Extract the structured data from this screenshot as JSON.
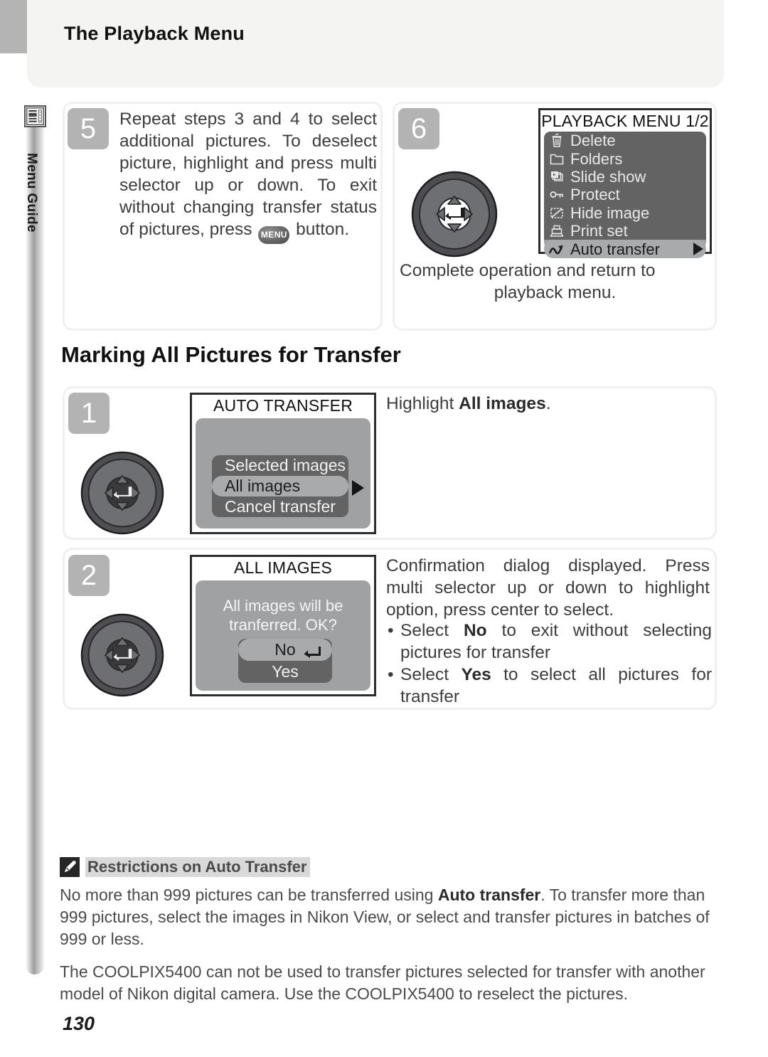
{
  "header": {
    "title": "The Playback Menu"
  },
  "side_tab": {
    "label": "Menu Guide",
    "icon": "menu-list-icon"
  },
  "section_heading": "Marking All Pictures for Transfer",
  "page_number": "130",
  "steps": {
    "step5": {
      "number": "5",
      "text_before_button": "Repeat steps 3 and 4 to select additional pictures.  To deselect picture, highlight and press multi selector up or down.  To exit without changing transfer status of pictures, press ",
      "button_label": "MENU",
      "text_after_button": " button."
    },
    "step6": {
      "number": "6",
      "caption_main": "Complete operation and return to",
      "caption_last": "playback menu.",
      "screen": {
        "title": "PLAYBACK MENU 1/2",
        "items": [
          {
            "icon": "trash-icon",
            "label": "Delete",
            "selected": false
          },
          {
            "icon": "folder-icon",
            "label": "Folders",
            "selected": false
          },
          {
            "icon": "slideshow-icon",
            "label": "Slide show",
            "selected": false
          },
          {
            "icon": "key-icon",
            "label": "Protect",
            "selected": false
          },
          {
            "icon": "hide-image-icon",
            "label": "Hide image",
            "selected": false
          },
          {
            "icon": "printer-icon",
            "label": "Print set",
            "selected": false
          },
          {
            "icon": "auto-transfer-icon",
            "label": "Auto transfer",
            "selected": true
          }
        ]
      }
    },
    "step1": {
      "number": "1",
      "caption_plain": "Highlight ",
      "caption_bold": "All images",
      "caption_tail": ".",
      "screen": {
        "title": "AUTO TRANSFER",
        "options": [
          {
            "label": "Selected images",
            "selected": false
          },
          {
            "label": "All images",
            "selected": true
          },
          {
            "label": "Cancel transfer",
            "selected": false
          }
        ]
      }
    },
    "step2": {
      "number": "2",
      "caption_intro": "Confirmation dialog displayed.  Press multi selector up or down to highlight option, press center to select.",
      "bullets": [
        {
          "pre": "Select ",
          "bold": "No",
          "post": " to exit without selecting pictures for transfer"
        },
        {
          "pre": "Select ",
          "bold": "Yes",
          "post": " to select all pictures for transfer"
        }
      ],
      "screen": {
        "title": "ALL IMAGES",
        "message_line1": "All images will be",
        "message_line2": "tranferred.  OK?",
        "options": [
          {
            "label": "No",
            "selected": true
          },
          {
            "label": "Yes",
            "selected": false
          }
        ]
      }
    }
  },
  "note": {
    "icon": "pencil-icon",
    "title": "Restrictions on Auto Transfer",
    "paragraph1_pre": "No more than 999 pictures can be transferred using ",
    "paragraph1_bold": "Auto transfer",
    "paragraph1_post": ".  To transfer more than 999 pictures, select the images in Nikon View, or select and transfer pictures in batches of 999 or less.",
    "paragraph2": "The COOLPIX5400 can not be used to transfer pictures selected for transfer with another model of Nikon digital camera.  Use the COOLPIX5400 to reselect the pictures."
  },
  "colors": {
    "tab_gray": "#b4b4b4",
    "badge_gray": "#b3b3b3",
    "lcd_background": "#a0a1a3",
    "lcd_row": "#636363",
    "lcd_selected": "#a9aaac",
    "header_band": "#f4f4f2",
    "note_highlight": "#d9d9d9",
    "text": "#3d3d3d"
  }
}
